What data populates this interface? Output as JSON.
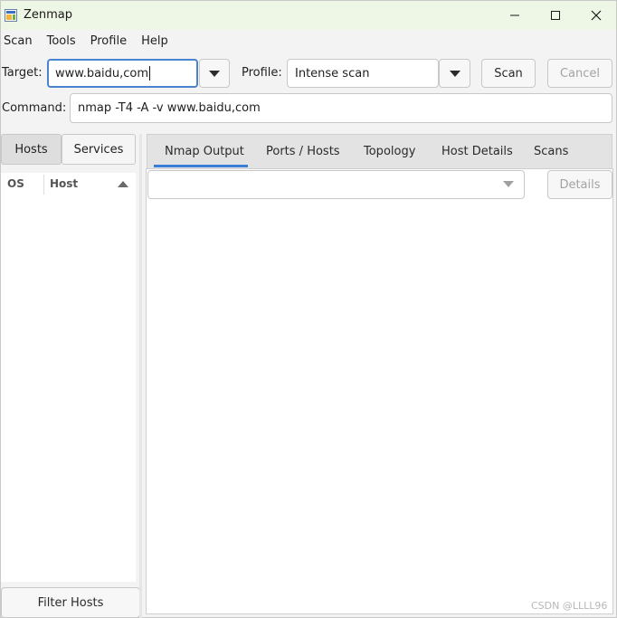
{
  "window": {
    "title": "Zenmap",
    "minimize_glyph": "—",
    "maximize_glyph": "☐",
    "close_glyph": "✕"
  },
  "menu": [
    "Scan",
    "Tools",
    "Profile",
    "Help"
  ],
  "toolbar": {
    "target_label": "Target:",
    "target_value": "www.baidu,com",
    "profile_label": "Profile:",
    "profile_value": "Intense scan",
    "scan_label": "Scan",
    "cancel_label": "Cancel"
  },
  "command": {
    "label": "Command:",
    "value": "nmap -T4 -A -v www.baidu,com"
  },
  "left_panel": {
    "hosts_tab": "Hosts",
    "services_tab": "Services",
    "col_os": "OS",
    "col_host": "Host",
    "filter_button": "Filter Hosts"
  },
  "notebook": {
    "tabs": [
      "Nmap Output",
      "Ports / Hosts",
      "Topology",
      "Host Details",
      "Scans"
    ],
    "active_tab": "Nmap Output",
    "details_button": "Details"
  },
  "watermark": "CSDN @LLLL96",
  "icons": {
    "app": "zenmap-icon",
    "dropdown": "chevron-down-icon",
    "sort": "sort-ascending-icon"
  },
  "colors": {
    "titlebar_bg": "#eef6e6",
    "accent": "#3a7fd6",
    "focus_border": "#4a84d0"
  }
}
